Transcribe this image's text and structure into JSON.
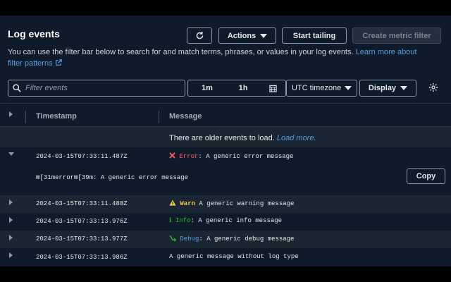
{
  "header": {
    "title": "Log events",
    "description": "You can use the filter bar below to search for and match terms, phrases, or values in your log events.",
    "learn_more": "Learn more about filter patterns"
  },
  "toolbar": {
    "actions_label": "Actions",
    "start_tailing_label": "Start tailing",
    "create_metric_filter_label": "Create metric filter"
  },
  "filters": {
    "search_placeholder": "Filter events",
    "range_1m": "1m",
    "range_1h": "1h",
    "timezone": "UTC timezone",
    "display_label": "Display"
  },
  "table": {
    "col_timestamp": "Timestamp",
    "col_message": "Message",
    "older_text": "There are older events to load.",
    "load_more": "Load more.",
    "copy_label": "Copy",
    "expanded_raw": "⊠[31merror⊠[39m: A generic error message",
    "rows": [
      {
        "timestamp": "2024-03-15T07:33:11.487Z",
        "level": "Error",
        "sep": ":",
        "message": " A generic error message"
      },
      {
        "timestamp": "2024-03-15T07:33:11.488Z",
        "level": "Warn",
        "sep": "",
        "message": " A generic warning message"
      },
      {
        "timestamp": "2024-03-15T07:33:13.976Z",
        "level": "Info",
        "sep": ":",
        "message": " A generic info message"
      },
      {
        "timestamp": "2024-03-15T07:33:13.977Z",
        "level": "Debug",
        "sep": ":",
        "message": " A generic debug message"
      },
      {
        "timestamp": "2024-03-15T07:33:13.986Z",
        "level": "",
        "sep": "",
        "message": "A generic message without log type"
      }
    ]
  },
  "colors": {
    "background": "#0f1b2a",
    "row_alt": "#1b2633",
    "link": "#539fe5",
    "error": "#ff5d64",
    "warn": "#f2c94c",
    "info": "#2bb534",
    "debug": "#539fe5"
  },
  "icons": [
    "refresh-icon",
    "search-icon",
    "calendar-icon",
    "gear-icon",
    "external-link-icon",
    "error-x-icon",
    "warning-icon",
    "info-icon",
    "debug-icon"
  ]
}
